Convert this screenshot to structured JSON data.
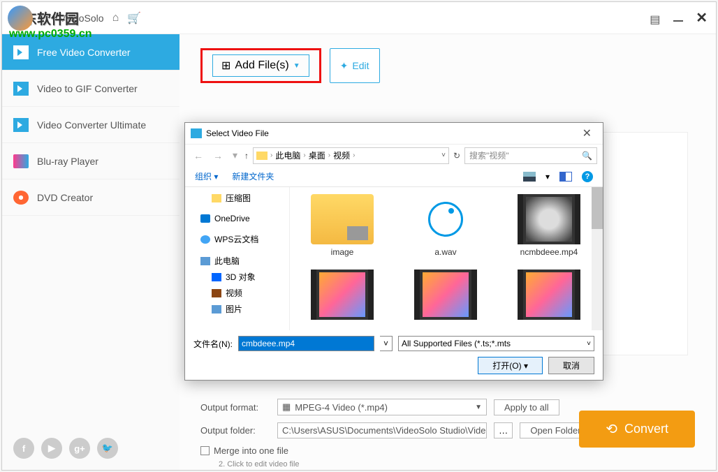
{
  "watermark": {
    "line1": "河东软件园",
    "url": "www.pc0359.cn"
  },
  "app": {
    "title": "VideoSolo"
  },
  "sidebar": {
    "items": [
      {
        "label": "Free Video Converter"
      },
      {
        "label": "Video to GIF Converter"
      },
      {
        "label": "Video Converter Ultimate"
      },
      {
        "label": "Blu-ray Player"
      },
      {
        "label": "DVD Creator"
      }
    ]
  },
  "toolbar": {
    "add_files": "Add File(s)",
    "edit": "Edit"
  },
  "output": {
    "format_label": "Output format:",
    "format_value": "MPEG-4 Video (*.mp4)",
    "folder_label": "Output folder:",
    "folder_value": "C:\\Users\\ASUS\\Documents\\VideoSolo Studio\\Vide",
    "apply_all": "Apply to all",
    "open_folder": "Open Folder",
    "merge": "Merge into one file",
    "convert": "Convert"
  },
  "dialog": {
    "title": "Select Video File",
    "breadcrumb": [
      "此电脑",
      "桌面",
      "视频"
    ],
    "search_placeholder": "搜索\"视频\"",
    "organize": "组织",
    "new_folder": "新建文件夹",
    "tree": [
      {
        "label": "压缩图",
        "cls": "ti-folder",
        "indent": true
      },
      {
        "label": "OneDrive",
        "cls": "ti-onedrive",
        "indent": false
      },
      {
        "label": "WPS云文档",
        "cls": "ti-cloud",
        "indent": false
      },
      {
        "label": "此电脑",
        "cls": "ti-pc",
        "indent": false
      },
      {
        "label": "3D 对象",
        "cls": "ti-3d",
        "indent": true
      },
      {
        "label": "视频",
        "cls": "ti-video",
        "indent": true
      },
      {
        "label": "图片",
        "cls": "ti-pic",
        "indent": true
      }
    ],
    "files": [
      {
        "label": "image",
        "type": "folder"
      },
      {
        "label": "a.wav",
        "type": "audio"
      },
      {
        "label": "ncmbdeee.mp4",
        "type": "video-car"
      },
      {
        "label": "",
        "type": "video-anime"
      },
      {
        "label": "",
        "type": "video-anime"
      },
      {
        "label": "",
        "type": "video-anime"
      }
    ],
    "filename_label": "文件名(N):",
    "filename_value": "cmbdeee.mp4",
    "filetype": "All Supported Files (*.ts;*.mts",
    "open": "打开(O)",
    "cancel": "取消"
  },
  "hint": "2. Click                                       to edit video file"
}
